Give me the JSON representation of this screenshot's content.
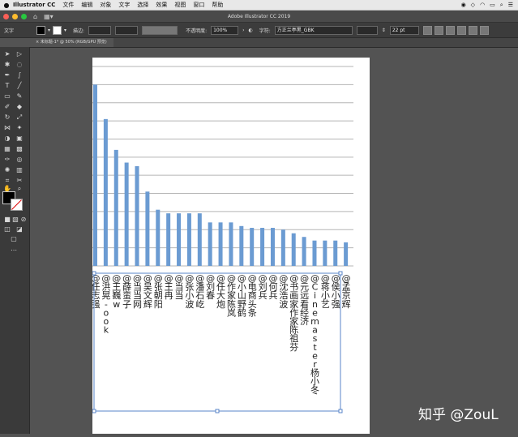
{
  "menubar": {
    "app_name": "Illustrator CC",
    "items": [
      "文件",
      "编辑",
      "对象",
      "文字",
      "选择",
      "效果",
      "视图",
      "窗口",
      "帮助"
    ]
  },
  "window": {
    "title": "Adobe Illustrator CC 2019"
  },
  "control_bar": {
    "context_label": "文字",
    "stroke_label": "描边:",
    "opacity_label": "不透明度:",
    "opacity_value": "100%",
    "font_label": "字符:",
    "font_name": "方正兰亭黑_GBK",
    "font_size": "22 pt"
  },
  "document_tab": {
    "label": "未标题-1* @ 50% (RGB/GPU 预览)"
  },
  "colors": {
    "bar": "#6b9bd2",
    "grid": "#b5b5b5",
    "selection": "#5a86c8"
  },
  "chart_data": {
    "type": "bar",
    "orientation": "vertical",
    "grid": true,
    "categories": [
      "@任志强",
      "@洪晃-ook",
      "@王巍w",
      "@薛蛮子",
      "@当当网",
      "@吴文辉",
      "@张朝阳",
      "@王冉",
      "@当当",
      "@张小波",
      "@潘石屹",
      "@刘春",
      "@任大炮",
      "@作家陈岚",
      "@小山野鹤",
      "@电商头条",
      "@刘兵",
      "@何兵",
      "@沈浩波",
      "@书画家作家陈祖芬",
      "@元远看经济",
      "@Cinemaster杨小冬",
      "@蒋小艺",
      "@侯小强",
      "@孟京辉"
    ],
    "values": [
      100,
      81,
      64,
      57,
      55,
      41,
      31,
      29,
      29,
      29,
      29,
      24,
      24,
      24,
      22,
      21,
      21,
      21,
      20,
      18,
      16,
      14,
      14,
      14,
      13
    ],
    "ylim": [
      0,
      110
    ],
    "gridlines": 11,
    "title": "",
    "xlabel": "",
    "ylabel": ""
  },
  "watermark": "知乎 @ZouL"
}
